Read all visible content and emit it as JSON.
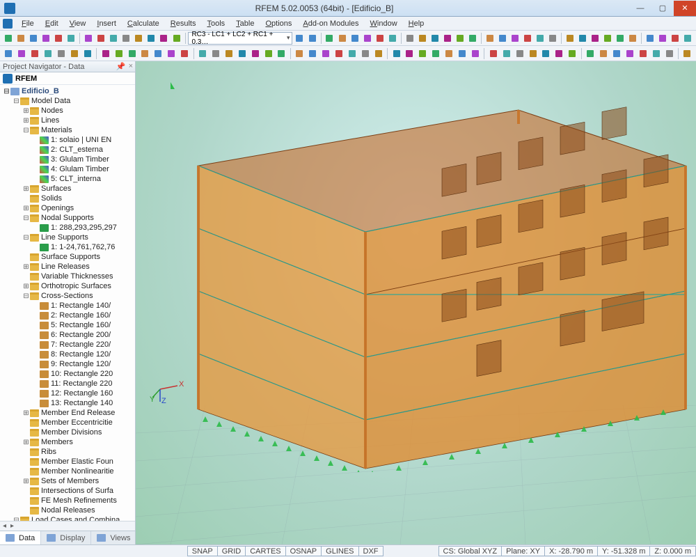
{
  "title": "RFEM 5.02.0053 (64bit) - [Edificio_B]",
  "menu": [
    "File",
    "Edit",
    "View",
    "Insert",
    "Calculate",
    "Results",
    "Tools",
    "Table",
    "Options",
    "Add-on Modules",
    "Window",
    "Help"
  ],
  "toolbar_combo": "RC3 - LC1 + LC2 + RC1 + 0.3…",
  "navigator": {
    "header": "Project Navigator - Data",
    "root": "RFEM",
    "project": "Edificio_B",
    "model_data": "Model Data",
    "items": [
      {
        "t": "Nodes",
        "d": 2,
        "ic": "ic-folder",
        "ex": "⊞"
      },
      {
        "t": "Lines",
        "d": 2,
        "ic": "ic-folder",
        "ex": "⊞"
      },
      {
        "t": "Materials",
        "d": 2,
        "ic": "ic-folder",
        "ex": "⊟"
      },
      {
        "t": "1: solaio | UNI EN",
        "d": 3,
        "ic": "ic-mat"
      },
      {
        "t": "2: CLT_esterna",
        "d": 3,
        "ic": "ic-mat"
      },
      {
        "t": "3: Glulam Timber",
        "d": 3,
        "ic": "ic-mat"
      },
      {
        "t": "4: Glulam Timber",
        "d": 3,
        "ic": "ic-mat"
      },
      {
        "t": "5: CLT_interna",
        "d": 3,
        "ic": "ic-mat"
      },
      {
        "t": "Surfaces",
        "d": 2,
        "ic": "ic-folder",
        "ex": "⊞"
      },
      {
        "t": "Solids",
        "d": 2,
        "ic": "ic-folder"
      },
      {
        "t": "Openings",
        "d": 2,
        "ic": "ic-folder",
        "ex": "⊞"
      },
      {
        "t": "Nodal Supports",
        "d": 2,
        "ic": "ic-folder",
        "ex": "⊟"
      },
      {
        "t": "1: 288,293,295,297",
        "d": 3,
        "ic": "ic-support"
      },
      {
        "t": "Line Supports",
        "d": 2,
        "ic": "ic-folder",
        "ex": "⊟"
      },
      {
        "t": "1: 1-24,761,762,76",
        "d": 3,
        "ic": "ic-support"
      },
      {
        "t": "Surface Supports",
        "d": 2,
        "ic": "ic-folder"
      },
      {
        "t": "Line Releases",
        "d": 2,
        "ic": "ic-folder",
        "ex": "⊞"
      },
      {
        "t": "Variable Thicknesses",
        "d": 2,
        "ic": "ic-folder"
      },
      {
        "t": "Orthotropic Surfaces",
        "d": 2,
        "ic": "ic-folder",
        "ex": "⊞"
      },
      {
        "t": "Cross-Sections",
        "d": 2,
        "ic": "ic-folder",
        "ex": "⊟"
      },
      {
        "t": "1: Rectangle 140/",
        "d": 3,
        "ic": "ic-leaf"
      },
      {
        "t": "2: Rectangle 160/",
        "d": 3,
        "ic": "ic-leaf"
      },
      {
        "t": "5: Rectangle 160/",
        "d": 3,
        "ic": "ic-leaf"
      },
      {
        "t": "6: Rectangle 200/",
        "d": 3,
        "ic": "ic-leaf"
      },
      {
        "t": "7: Rectangle 220/",
        "d": 3,
        "ic": "ic-leaf"
      },
      {
        "t": "8: Rectangle 120/",
        "d": 3,
        "ic": "ic-leaf"
      },
      {
        "t": "9: Rectangle 120/",
        "d": 3,
        "ic": "ic-leaf"
      },
      {
        "t": "10: Rectangle 220",
        "d": 3,
        "ic": "ic-leaf"
      },
      {
        "t": "11: Rectangle 220",
        "d": 3,
        "ic": "ic-leaf"
      },
      {
        "t": "12: Rectangle 160",
        "d": 3,
        "ic": "ic-leaf"
      },
      {
        "t": "13: Rectangle 140",
        "d": 3,
        "ic": "ic-leaf"
      },
      {
        "t": "Member End Release",
        "d": 2,
        "ic": "ic-folder",
        "ex": "⊞"
      },
      {
        "t": "Member Eccentricitie",
        "d": 2,
        "ic": "ic-folder"
      },
      {
        "t": "Member Divisions",
        "d": 2,
        "ic": "ic-folder"
      },
      {
        "t": "Members",
        "d": 2,
        "ic": "ic-folder",
        "ex": "⊞"
      },
      {
        "t": "Ribs",
        "d": 2,
        "ic": "ic-folder"
      },
      {
        "t": "Member Elastic Foun",
        "d": 2,
        "ic": "ic-folder"
      },
      {
        "t": "Member Nonlinearitie",
        "d": 2,
        "ic": "ic-folder"
      },
      {
        "t": "Sets of Members",
        "d": 2,
        "ic": "ic-folder",
        "ex": "⊞"
      },
      {
        "t": "Intersections of Surfa",
        "d": 2,
        "ic": "ic-folder"
      },
      {
        "t": "FE Mesh Refinements",
        "d": 2,
        "ic": "ic-folder"
      },
      {
        "t": "Nodal Releases",
        "d": 2,
        "ic": "ic-folder"
      }
    ],
    "load_cases": "Load Cases and Combina",
    "tabs": [
      "Data",
      "Display",
      "Views"
    ]
  },
  "status": {
    "toggles": [
      "SNAP",
      "GRID",
      "CARTES",
      "OSNAP",
      "GLINES",
      "DXF"
    ],
    "cs": "CS: Global XYZ",
    "plane": "Plane: XY",
    "x": "X: -28.790 m",
    "y": "Y: -51.328 m",
    "z": "Z: 0.000 m"
  }
}
